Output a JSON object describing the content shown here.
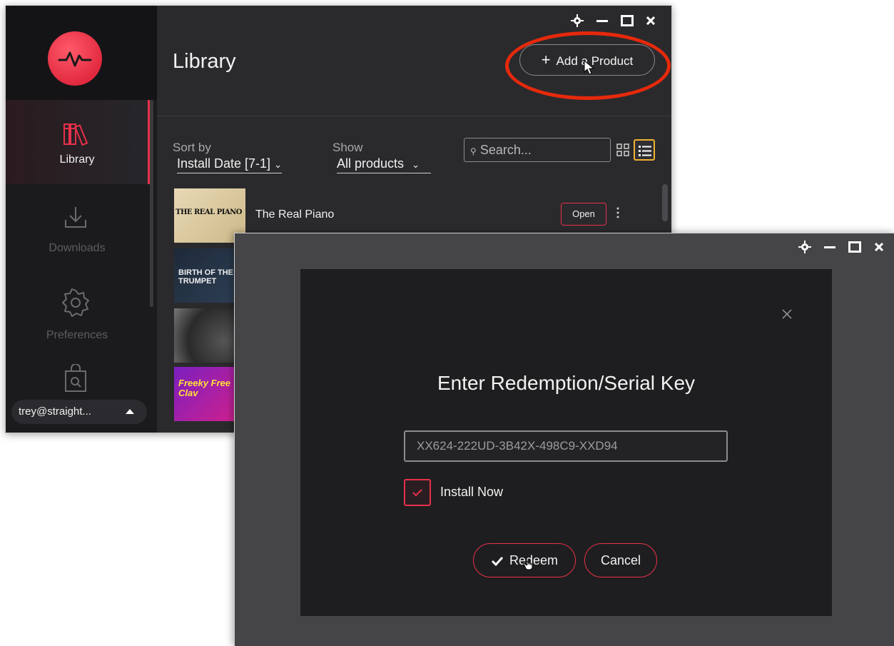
{
  "library_window": {
    "title": "Library",
    "sidebar": {
      "items": [
        {
          "label": "Library",
          "icon": "library-books-icon",
          "active": true
        },
        {
          "label": "Downloads",
          "icon": "download-icon",
          "active": false
        },
        {
          "label": "Preferences",
          "icon": "gear-icon",
          "active": false
        },
        {
          "label": "",
          "icon": "store-bag-icon",
          "active": false
        }
      ],
      "user_email": "trey@straight..."
    },
    "add_product_label": "Add a Product",
    "sort": {
      "label": "Sort by",
      "value": "Install Date [7-1]"
    },
    "show": {
      "label": "Show",
      "value": "All products"
    },
    "search": {
      "placeholder": "Search..."
    },
    "products": [
      {
        "name": "The Real Piano",
        "thumb_text": "THE REAL PIANO",
        "action": "Open"
      },
      {
        "name": "",
        "thumb_text": "BIRTH OF THE TRUMPET"
      },
      {
        "name": "",
        "thumb_text": ""
      },
      {
        "name": "",
        "thumb_text": "Freeky Free Clav"
      }
    ],
    "annotation_color": "#e6290b"
  },
  "redeem_window": {
    "dialog_title": "Enter Redemption/Serial Key",
    "serial_key_value": "XX624-222UD-3B42X-498C9-XXD94",
    "install_now_label": "Install Now",
    "install_now_checked": true,
    "redeem_label": "Redeem",
    "cancel_label": "Cancel"
  },
  "colors": {
    "accent": "#e8304a",
    "logo": "#e22a3f",
    "highlight": "#f0b132"
  }
}
